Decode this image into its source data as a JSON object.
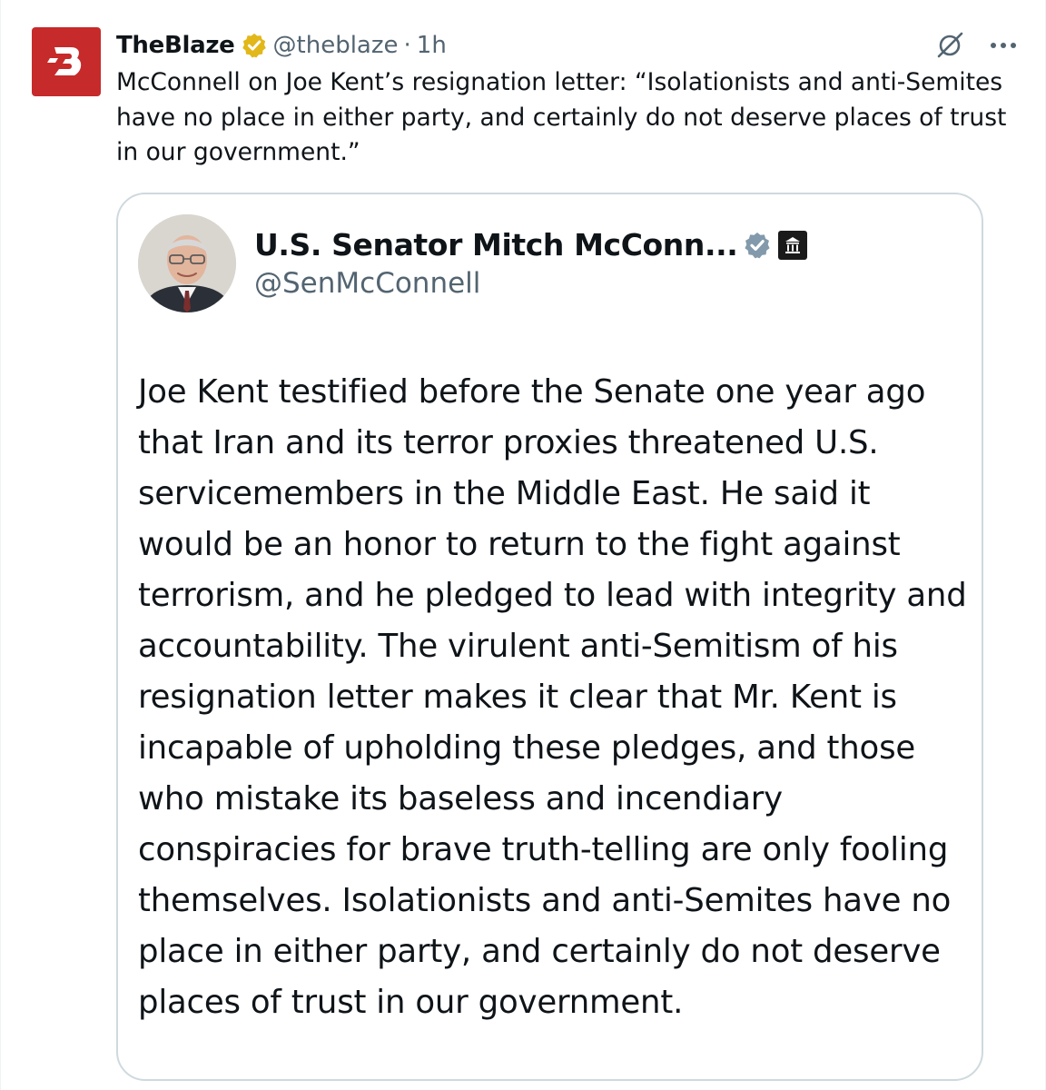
{
  "tweet": {
    "author_name": "TheBlaze",
    "author_handle": "@theblaze",
    "separator": "·",
    "time": "1h",
    "text": "McConnell on Joe Kent’s resignation letter: “Isolationists and anti-Semites have no place in either party, and certainly do not deserve places of trust in our government.”",
    "avatar_icon": "theblaze-logo-icon",
    "verified_badge": "gold-verified-badge-icon",
    "actions": [
      "grok-icon",
      "more-options-icon"
    ]
  },
  "quote": {
    "author_name": "U.S. Senator Mitch McConn...",
    "author_handle": "@SenMcConnell",
    "verified_badge": "blue-verified-badge-icon",
    "affiliation_badge": "government-building-icon",
    "text": "Joe Kent testified before the Senate one year ago that Iran and its terror proxies threatened U.S. servicemembers in the Middle East. He said it would be an honor to return to the fight against terrorism, and he pledged to lead with integrity and accountability. The virulent anti-Semitism of his resignation letter makes it clear that Mr. Kent is incapable of upholding these pledges, and those who mistake its baseless and incendiary conspiracies for brave truth-telling are only fooling themselves. Isolationists and anti-Semites have no place in either party, and certainly do not deserve places of trust in our government."
  },
  "colors": {
    "brand_red": "#c62a2a",
    "gold_badge": "#e2b719",
    "blue_badge": "#829aab",
    "text_primary": "#0f1419",
    "text_secondary": "#536471",
    "border": "#cfd9de"
  }
}
